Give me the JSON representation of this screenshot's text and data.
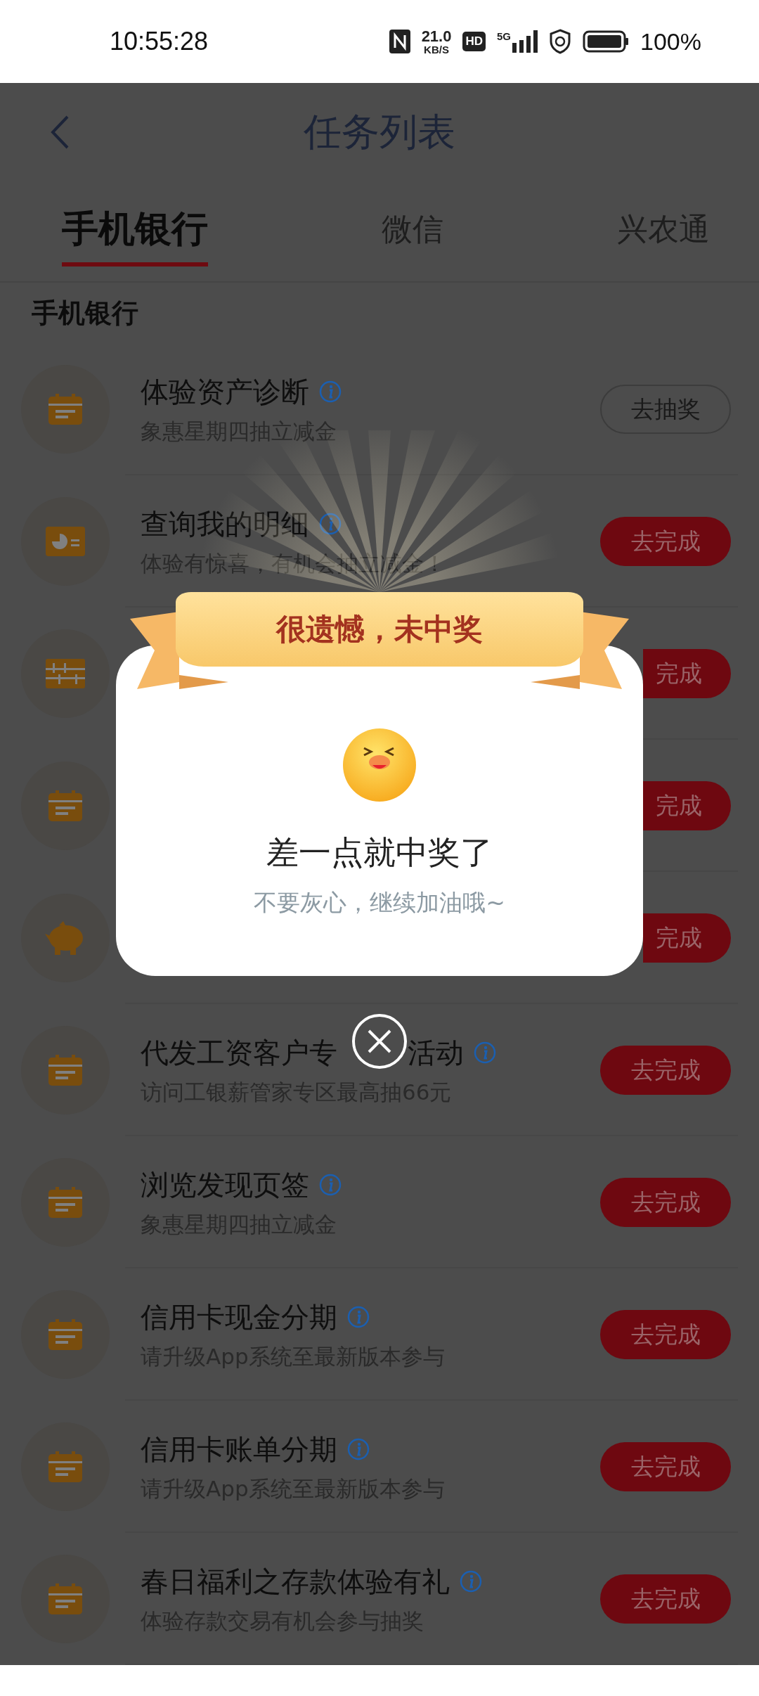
{
  "status_bar": {
    "time": "10:55:28",
    "net_speed": "21.0",
    "net_unit": "KB/S",
    "hd": "HD",
    "network": "5G",
    "battery": "100%"
  },
  "header": {
    "title": "任务列表"
  },
  "tabs": [
    {
      "label": "手机银行",
      "selected": true
    },
    {
      "label": "微信",
      "selected": false
    },
    {
      "label": "兴农通",
      "selected": false
    }
  ],
  "section_title": "手机银行",
  "tasks": [
    {
      "kind": "calendar",
      "title": "体验资产诊断",
      "subtitle": "象惠星期四抽立减金",
      "button": {
        "kind": "outline",
        "label": "去抽奖"
      }
    },
    {
      "kind": "chart",
      "title": "查询我的明细",
      "subtitle": "体验有惊喜，有机会抽立减金！",
      "button": {
        "kind": "filled",
        "label": "去完成"
      }
    },
    {
      "kind": "ruler",
      "button": {
        "kind": "partial",
        "label": "完成"
      }
    },
    {
      "kind": "calendar",
      "button": {
        "kind": "partial",
        "label": "完成"
      }
    },
    {
      "kind": "piggy",
      "button": {
        "kind": "partial",
        "label": "完成"
      }
    },
    {
      "kind": "calendar",
      "title": "代发工资客户专",
      "title_tail": "活动",
      "subtitle": "访问工银薪管家专区最高抽66元",
      "button": {
        "kind": "filled",
        "label": "去完成"
      }
    },
    {
      "kind": "calendar",
      "title": "浏览发现页签",
      "subtitle": "象惠星期四抽立减金",
      "button": {
        "kind": "filled",
        "label": "去完成"
      }
    },
    {
      "kind": "calendar",
      "title": "信用卡现金分期",
      "subtitle": "请升级App系统至最新版本参与",
      "button": {
        "kind": "filled",
        "label": "去完成"
      }
    },
    {
      "kind": "calendar",
      "title": "信用卡账单分期",
      "subtitle": "请升级App系统至最新版本参与",
      "button": {
        "kind": "filled",
        "label": "去完成"
      }
    },
    {
      "kind": "calendar",
      "title": "春日福利之存款体验有礼",
      "subtitle": "体验存款交易有机会参与抽奖",
      "button": {
        "kind": "filled",
        "label": "去完成"
      }
    }
  ],
  "modal": {
    "banner": "很遗憾，未中奖",
    "heading": "差一点就中奖了",
    "message": "不要灰心，继续加油哦~"
  }
}
